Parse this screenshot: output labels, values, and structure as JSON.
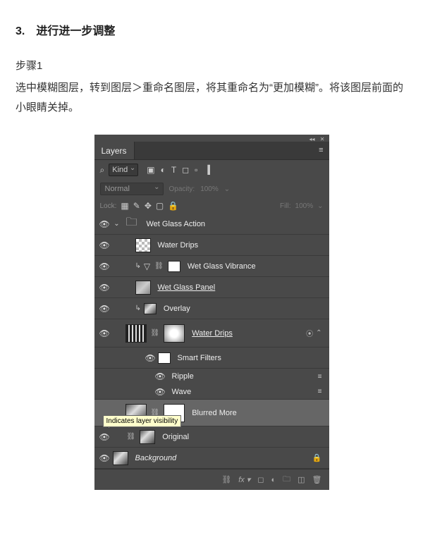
{
  "doc": {
    "heading": "3. 进行进一步调整",
    "step_label": "步骤1",
    "body": "选中模糊图层，转到图层＞重命名图层，将其重命名为“更加模糊”。将该图层前面的小眼睛关掉。"
  },
  "panel": {
    "tab": "Layers",
    "filter": {
      "label": "Kind"
    },
    "blend": {
      "mode": "Normal",
      "opacity_label": "Opacity:",
      "opacity": "100%"
    },
    "lock": {
      "label": "Lock:",
      "fill_label": "Fill:",
      "fill": "100%"
    },
    "layers": {
      "group": "Wet Glass Action",
      "water_drips": "Water Drips",
      "vibrance": "Wet Glass Vibrance",
      "panel_layer": "Wet Glass Panel",
      "overlay": "Overlay",
      "water_drips2": "Water Drips ",
      "smart_filters": "Smart Filters",
      "ripple": "Ripple",
      "wave": "Wave",
      "blurred": "Blurred More",
      "original": "Original",
      "background": "Background"
    },
    "tooltip": "Indicates layer visibility"
  }
}
